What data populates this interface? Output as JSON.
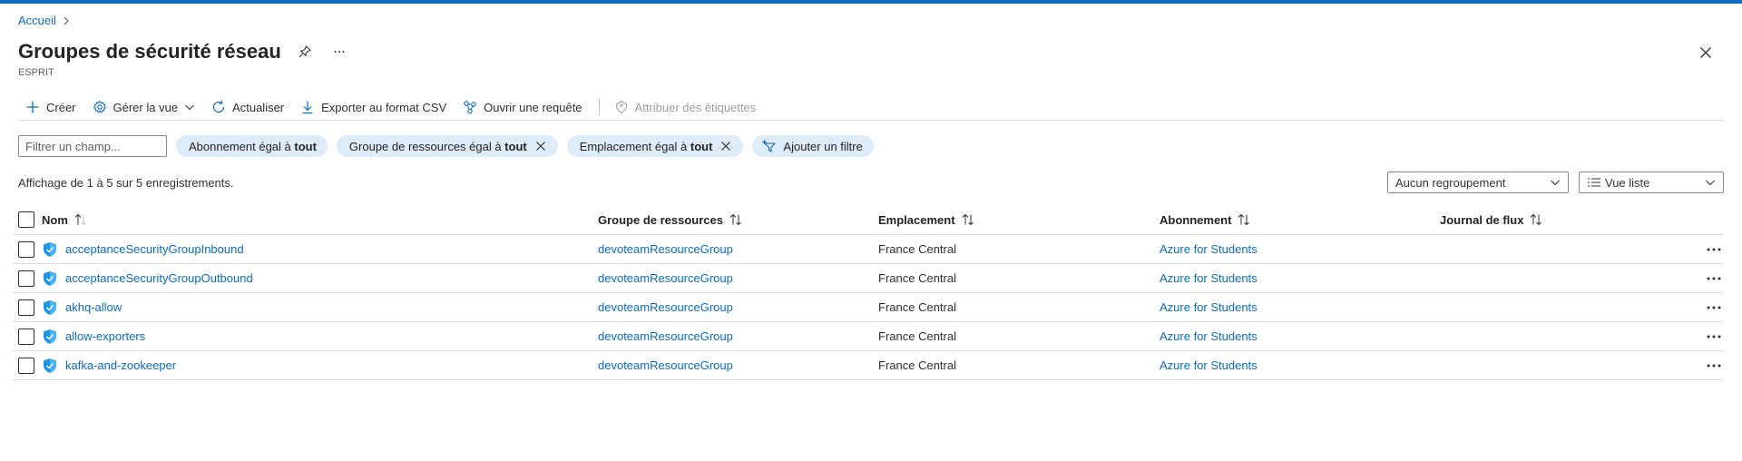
{
  "breadcrumb": {
    "home": "Accueil"
  },
  "header": {
    "title": "Groupes de sécurité réseau",
    "subtitle": "ESPRIT"
  },
  "toolbar": {
    "create": "Créer",
    "manage_view": "Gérer la vue",
    "refresh": "Actualiser",
    "export_csv": "Exporter au format CSV",
    "open_query": "Ouvrir une requête",
    "assign_tags": "Attribuer des étiquettes"
  },
  "filters": {
    "placeholder": "Filtrer un champ...",
    "pills": [
      {
        "label": "Abonnement égal à ",
        "value": "tout"
      },
      {
        "label": "Groupe de ressources égal à ",
        "value": "tout"
      },
      {
        "label": "Emplacement égal à ",
        "value": "tout"
      }
    ],
    "add_filter": "Ajouter un filtre"
  },
  "info": "Affichage de 1 à 5 sur 5 enregistrements.",
  "grouping": {
    "selected": "Aucun regroupement"
  },
  "view": {
    "selected": "Vue liste"
  },
  "table": {
    "columns": [
      "Nom",
      "Groupe de ressources",
      "Emplacement",
      "Abonnement",
      "Journal de flux"
    ],
    "rows": [
      {
        "name": "acceptanceSecurityGroupInbound",
        "rg": "devoteamResourceGroup",
        "location": "France Central",
        "subscription": "Azure for Students",
        "flowlog": ""
      },
      {
        "name": "acceptanceSecurityGroupOutbound",
        "rg": "devoteamResourceGroup",
        "location": "France Central",
        "subscription": "Azure for Students",
        "flowlog": ""
      },
      {
        "name": "akhq-allow",
        "rg": "devoteamResourceGroup",
        "location": "France Central",
        "subscription": "Azure for Students",
        "flowlog": ""
      },
      {
        "name": "allow-exporters",
        "rg": "devoteamResourceGroup",
        "location": "France Central",
        "subscription": "Azure for Students",
        "flowlog": ""
      },
      {
        "name": "kafka-and-zookeeper",
        "rg": "devoteamResourceGroup",
        "location": "France Central",
        "subscription": "Azure for Students",
        "flowlog": ""
      }
    ]
  },
  "colors": {
    "accent": "#0f6cbd",
    "pill_bg": "#deecf9",
    "shield": "#1b93eb"
  },
  "icons": {
    "create": "plus-icon",
    "manage": "gear-icon",
    "refresh": "refresh-icon",
    "export": "download-icon",
    "query": "query-icon",
    "tags": "tag-icon",
    "resource": "shield-icon",
    "more": "more-icon"
  }
}
